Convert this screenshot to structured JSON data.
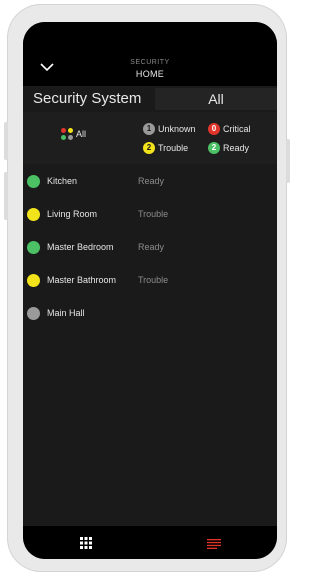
{
  "header": {
    "section": "SECURITY",
    "location": "HOME"
  },
  "title_row": {
    "title": "Security System",
    "filter": "All"
  },
  "legend": {
    "all_label": "All",
    "items": [
      {
        "count": "1",
        "label": "Unknown",
        "color": "#9a9a9a"
      },
      {
        "count": "0",
        "label": "Critical",
        "color": "#e0352b"
      },
      {
        "count": "2",
        "label": "Trouble",
        "color": "#f2e31a"
      },
      {
        "count": "2",
        "label": "Ready",
        "color": "#4cc064"
      }
    ]
  },
  "zones": [
    {
      "name": "Kitchen",
      "status": "Ready",
      "color": "#4cc064"
    },
    {
      "name": "Living Room",
      "status": "Trouble",
      "color": "#f2e31a"
    },
    {
      "name": "Master Bedroom",
      "status": "Ready",
      "color": "#4cc064"
    },
    {
      "name": "Master Bathroom",
      "status": "Trouble",
      "color": "#f2e31a"
    },
    {
      "name": "Main Hall",
      "status": "",
      "color": "#9a9a9a"
    }
  ],
  "nav": {
    "left_icon": "grid-icon",
    "right_icon": "list-icon",
    "active_color": "#e0352b"
  }
}
